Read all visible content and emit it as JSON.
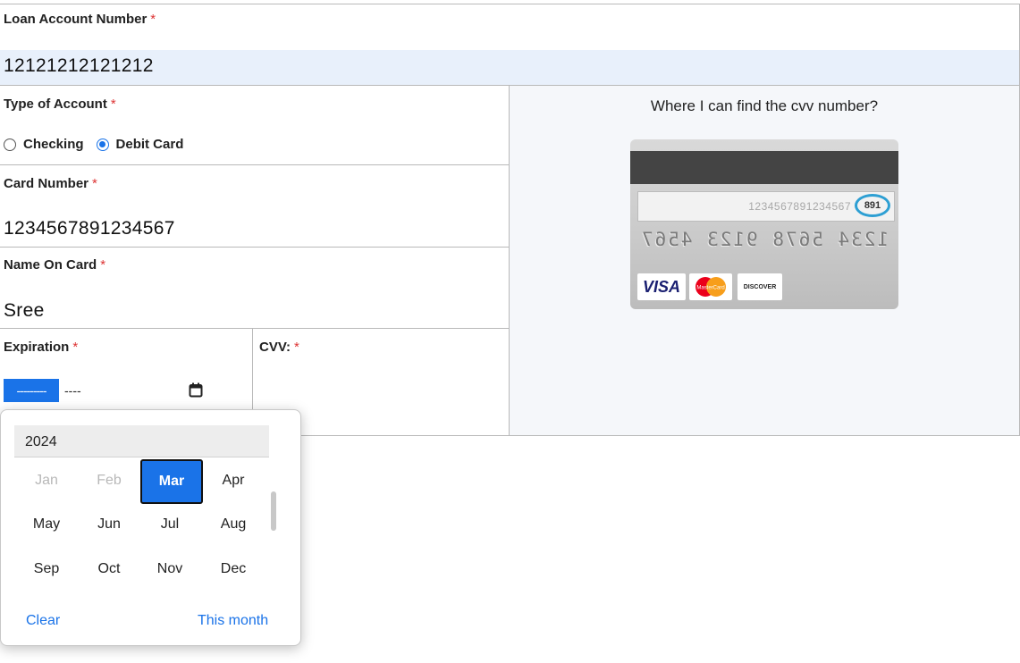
{
  "loan": {
    "label": "Loan Account Number",
    "required": "*",
    "value": "12121212121212"
  },
  "account_type": {
    "label": "Type of Account",
    "required": "*",
    "options": [
      {
        "label": "Checking",
        "checked": false
      },
      {
        "label": "Debit Card",
        "checked": true
      }
    ]
  },
  "card_number": {
    "label": "Card Number",
    "required": "*",
    "value": "1234567891234567"
  },
  "name_on_card": {
    "label": "Name On Card",
    "required": "*",
    "value": "Sree"
  },
  "expiration": {
    "label": "Expiration",
    "required": "*",
    "month_placeholder": "---------",
    "year_placeholder": "----"
  },
  "cvv": {
    "label": "CVV:",
    "required": "*"
  },
  "cvv_help": {
    "title": "Where I can find the cvv number?",
    "card_image": {
      "signature_number": "1234567891234567",
      "cvv_digits": "891",
      "embossed_number": "1234 5678 9123 4567",
      "logos": {
        "visa": "VISA",
        "mastercard": "MasterCard",
        "discover": "DISCOVER"
      }
    }
  },
  "month_picker": {
    "year": "2024",
    "months": [
      {
        "label": "Jan",
        "state": "disabled"
      },
      {
        "label": "Feb",
        "state": "disabled"
      },
      {
        "label": "Mar",
        "state": "selected"
      },
      {
        "label": "Apr",
        "state": "normal"
      },
      {
        "label": "May",
        "state": "normal"
      },
      {
        "label": "Jun",
        "state": "normal"
      },
      {
        "label": "Jul",
        "state": "normal"
      },
      {
        "label": "Aug",
        "state": "normal"
      },
      {
        "label": "Sep",
        "state": "normal"
      },
      {
        "label": "Oct",
        "state": "normal"
      },
      {
        "label": "Nov",
        "state": "normal"
      },
      {
        "label": "Dec",
        "state": "normal"
      }
    ],
    "clear_label": "Clear",
    "this_month_label": "This month"
  },
  "colors": {
    "accent": "#1a73e8",
    "required": "#d33333",
    "highlight_row": "#e8f0fb",
    "panel_bg": "#f5f7fa",
    "cvv_ring": "#2d9fd3"
  }
}
